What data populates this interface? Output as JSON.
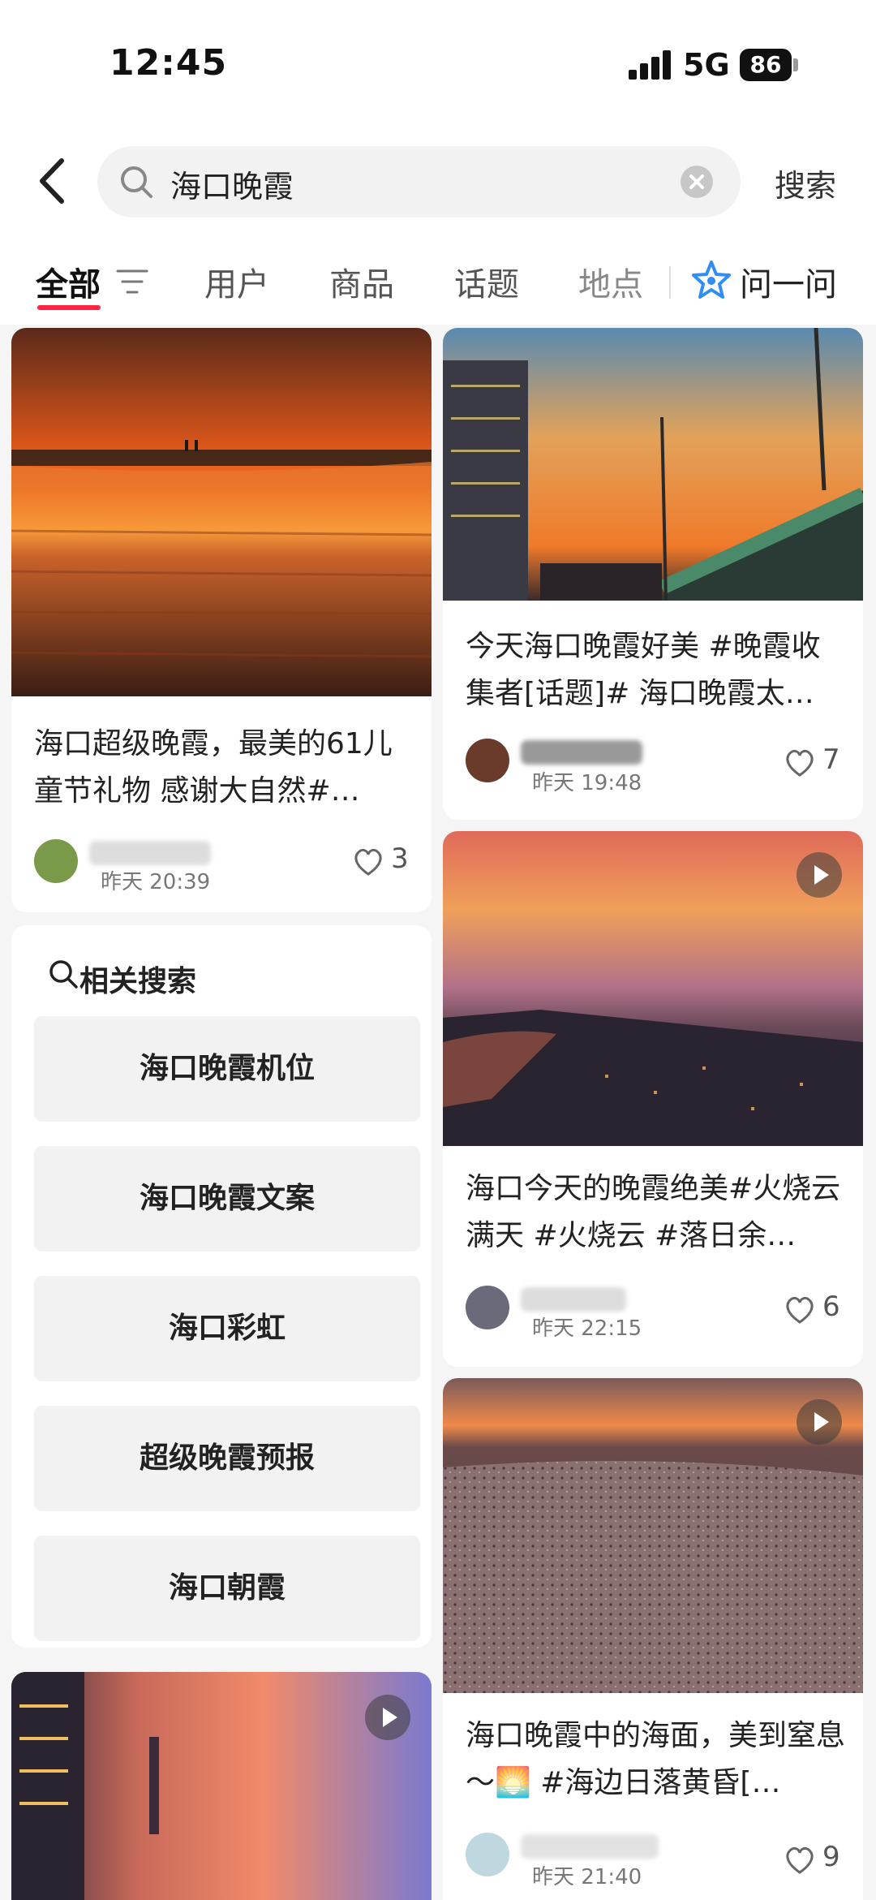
{
  "status_bar": {
    "time": "12:45",
    "network": "5G",
    "battery": "86"
  },
  "search": {
    "query": "海口晚霞",
    "submit_label": "搜索"
  },
  "tabs": [
    {
      "label": "全部"
    },
    {
      "label": "用户"
    },
    {
      "label": "商品"
    },
    {
      "label": "话题"
    },
    {
      "label": "地点"
    },
    {
      "label": "问一问"
    }
  ],
  "posts": [
    {
      "title": "海口超级晚霞，最美的61儿童节礼物 感谢大自然#…",
      "time": "昨天 20:39",
      "likes": "3",
      "video": false
    },
    {
      "title": "今天海口晚霞好美 #晚霞收集者[话题]# 海口晚霞太…",
      "time": "昨天 19:48",
      "likes": "7",
      "video": false
    },
    {
      "title": "海口今天的晚霞绝美#火烧云满天 #火烧云 #落日余…",
      "time": "昨天 22:15",
      "likes": "6",
      "video": true
    },
    {
      "title": "海口晚霞中的海面，美到窒息～🌅 #海边日落黄昏[…",
      "time": "昨天 21:40",
      "likes": "9",
      "video": true
    },
    {
      "title": "",
      "time": "",
      "likes": "",
      "video": true
    }
  ],
  "related": {
    "title": "相关搜索",
    "items": [
      "海口晚霞机位",
      "海口晚霞文案",
      "海口彩虹",
      "超级晚霞预报",
      "海口朝霞"
    ]
  },
  "colors": {
    "accent": "#ff2442",
    "ask_blue": "#2f8df5"
  }
}
